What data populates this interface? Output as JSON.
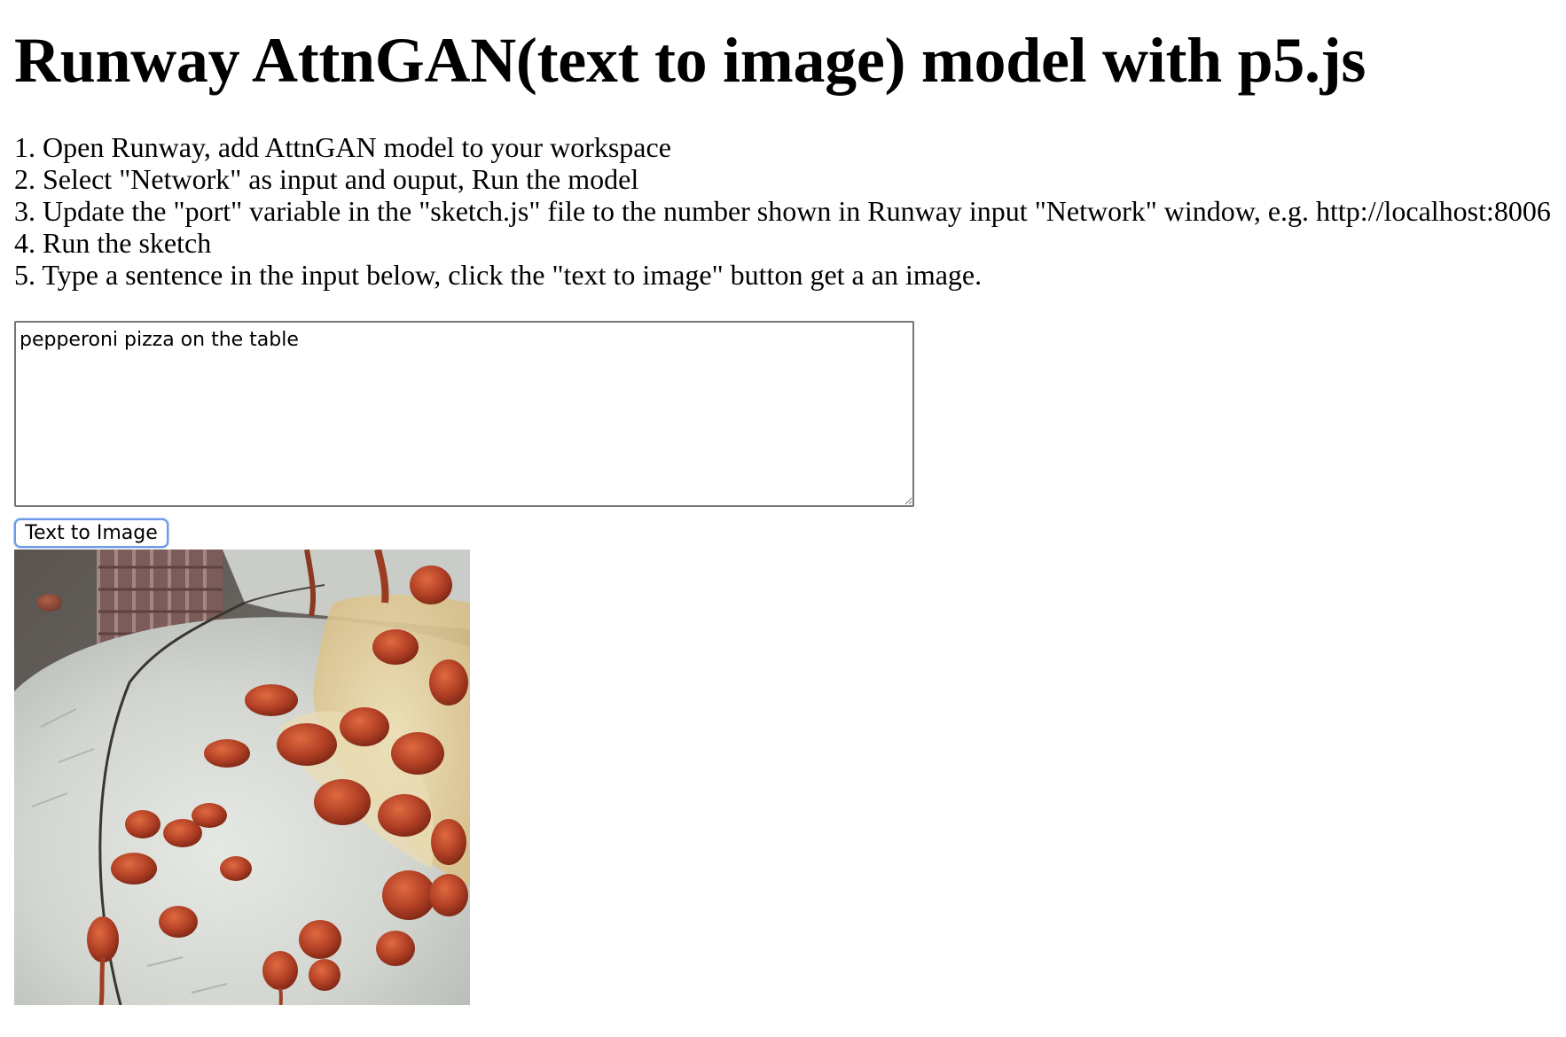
{
  "page": {
    "title": "Runway AttnGAN(text to image) model with p5.js"
  },
  "steps": [
    "1. Open Runway, add AttnGAN model to your workspace",
    "2. Select \"Network\" as input and ouput, Run the model",
    "3. Update the \"port\" variable in the \"sketch.js\" file to the number shown in Runway input \"Network\" window, e.g. http://localhost:8006",
    "4. Run the sketch",
    "5. Type a sentence in the input below, click the \"text to image\" button get a an image."
  ],
  "prompt": {
    "value": "pepperoni pizza on the table"
  },
  "button": {
    "label": "Text to Image"
  },
  "colors": {
    "button_focus_ring": "#6f9ae8",
    "textarea_border": "#767676",
    "pizza_sauce": "#b8442a",
    "plate": "#d8dbd6"
  },
  "result_image": {
    "subject": "generated-pizza-image"
  }
}
